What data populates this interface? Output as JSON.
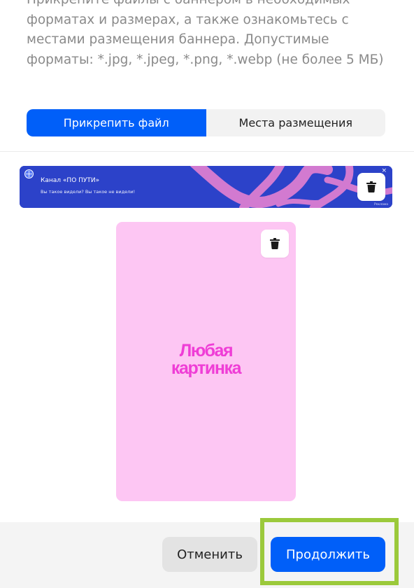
{
  "description": "Прикрепите файлы с баннером в необходимых форматах и размерах, а также ознакомьтесь с местами размещения баннера. Допустимые форматы: *.jpg, *.jpeg, *.png, *.webp (не более 5 МБ)",
  "tabs": [
    {
      "label": "Прикрепить файл",
      "active": true
    },
    {
      "label": "Места размещения",
      "active": false
    }
  ],
  "banner_preview": {
    "title": "Канал «ПО ПУТИ»",
    "subtitle": "Вы такое видели? Вы такое не видели!",
    "close_glyph": "×",
    "ad_label": "Реклама",
    "background_color": "#2c42c9",
    "accent_color": "#d27ad0"
  },
  "poster_preview": {
    "line1": "Любая",
    "line2": "картинка",
    "background_color": "#fdc6f3",
    "text_color": "#ef3dd6"
  },
  "icons": {
    "delete": "trash-icon"
  },
  "footer": {
    "cancel_label": "Отменить",
    "continue_label": "Продолжить",
    "highlight_color": "#9bc93b"
  },
  "colors": {
    "primary": "#005ff9"
  }
}
